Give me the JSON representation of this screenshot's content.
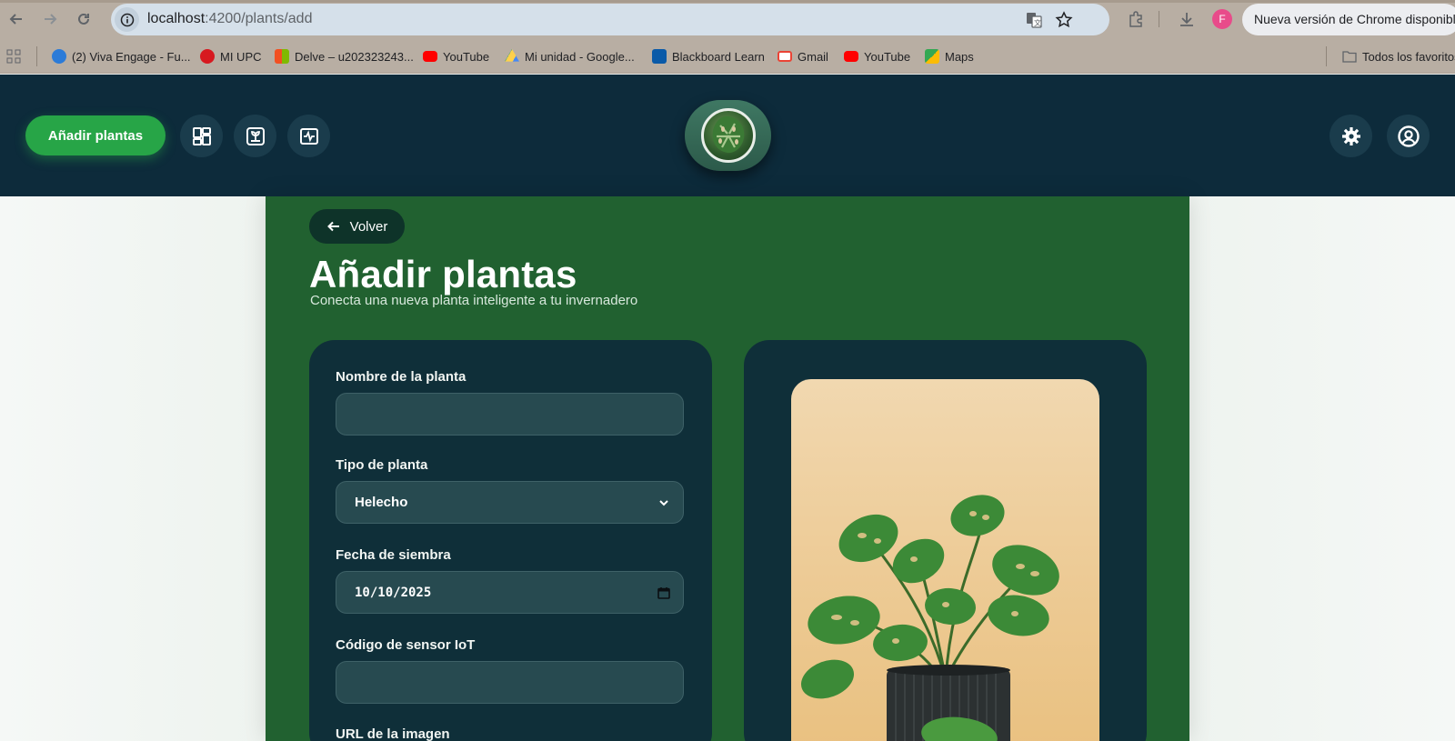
{
  "browser": {
    "url_host": "localhost",
    "url_path": ":4200/plants/add",
    "update_text": "Nueva versión de Chrome disponible",
    "profile_initial": "F"
  },
  "bookmarks": [
    {
      "label": "(2) Viva Engage - Fu...",
      "color": "#2b7bd8"
    },
    {
      "label": "MI UPC",
      "color": "#d71920"
    },
    {
      "label": "Delve – u202323243...",
      "color": "#e86a1e"
    },
    {
      "label": "YouTube",
      "color": "#ff0000"
    },
    {
      "label": "Mi unidad - Google...",
      "color": "#1fa463"
    },
    {
      "label": "Blackboard Learn",
      "color": "#0a5aa8"
    },
    {
      "label": "Gmail",
      "color": "#ea4335"
    },
    {
      "label": "YouTube",
      "color": "#ff0000"
    },
    {
      "label": "Maps",
      "color": "#34a853"
    }
  ],
  "bookmarks_folder": "Todos los favoritos",
  "header": {
    "add_label": "Añadir plantas"
  },
  "page": {
    "back_label": "Volver",
    "title": "Añadir plantas",
    "subtitle": "Conecta una nueva planta inteligente a tu invernadero"
  },
  "form": {
    "name_label": "Nombre de la planta",
    "name_value": "",
    "type_label": "Tipo de planta",
    "type_value": "Helecho",
    "date_label": "Fecha de siembra",
    "date_value": "10/10/2025",
    "sensor_label": "Código de sensor IoT",
    "sensor_value": "",
    "image_url_label": "URL de la imagen"
  },
  "colors": {
    "header_bg": "#0d2b3b",
    "accent_green": "#27a547",
    "page_green": "#216130",
    "card_bg": "#0f2f39"
  }
}
